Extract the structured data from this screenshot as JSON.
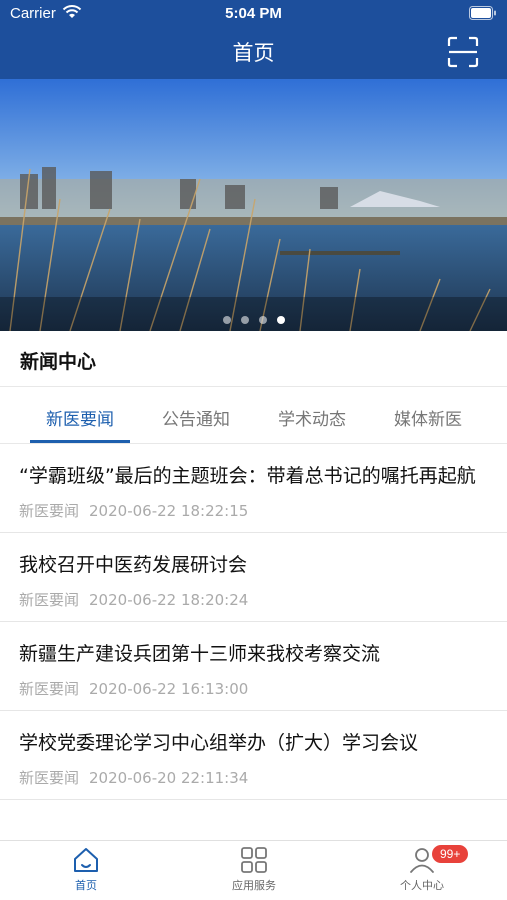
{
  "status_bar": {
    "carrier": "Carrier",
    "time": "5:04 PM"
  },
  "navbar": {
    "title": "首页",
    "scan_icon": "scan-icon"
  },
  "banner": {
    "slide_count": 4,
    "active_index": 3
  },
  "news_section": {
    "title": "新闻中心",
    "tabs": [
      {
        "label": "新医要闻",
        "active": true
      },
      {
        "label": "公告通知",
        "active": false
      },
      {
        "label": "学术动态",
        "active": false
      },
      {
        "label": "媒体新医",
        "active": false
      }
    ],
    "items": [
      {
        "title": "“学霸班级”最后的主题班会：带着总书记的嘱托再起航",
        "category": "新医要闻",
        "date": "2020-06-22 18:22:15"
      },
      {
        "title": "我校召开中医药发展研讨会",
        "category": "新医要闻",
        "date": "2020-06-22 18:20:24"
      },
      {
        "title": "新疆生产建设兵团第十三师来我校考察交流",
        "category": "新医要闻",
        "date": "2020-06-22 16:13:00"
      },
      {
        "title": "学校党委理论学习中心组举办（扩大）学习会议",
        "category": "新医要闻",
        "date": "2020-06-20 22:11:34"
      }
    ]
  },
  "tab_bar": {
    "items": [
      {
        "label": "首页",
        "icon": "home-icon",
        "active": true
      },
      {
        "label": "应用服务",
        "icon": "grid-icon",
        "active": false
      },
      {
        "label": "个人中心",
        "icon": "user-icon",
        "active": false,
        "badge": "99+"
      }
    ]
  },
  "colors": {
    "primary": "#1d4f9c",
    "accent": "#1d5fae",
    "badge": "#e8423b"
  }
}
